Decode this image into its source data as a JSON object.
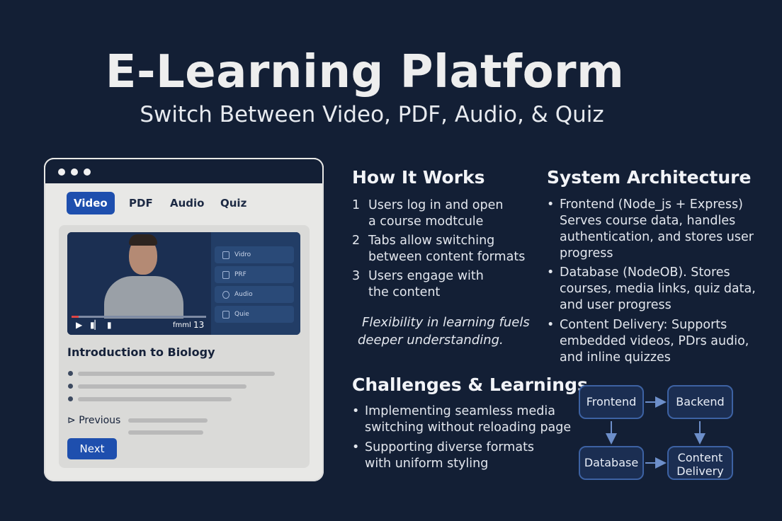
{
  "header": {
    "title": "E-Learning Platform",
    "subtitle": "Switch Between Video, PDF, Audio, & Quiz"
  },
  "mockup": {
    "tabs": [
      {
        "label": "Video",
        "active": true
      },
      {
        "label": "PDF",
        "active": false
      },
      {
        "label": "Audio",
        "active": false
      },
      {
        "label": "Quiz",
        "active": false
      }
    ],
    "player": {
      "side_items": [
        "Vidro",
        "PRF",
        "Audio",
        "Quie"
      ],
      "time_text": "fmml",
      "time_value": "13",
      "progress": 0.05
    },
    "course_title": "Introduction to Biology",
    "previous_label": "Previous",
    "next_label": "Next"
  },
  "how_it_works": {
    "heading": "How It Works",
    "steps": [
      {
        "num": "1",
        "line1": "Users log in and open",
        "line2": "a course modtcule"
      },
      {
        "num": "2",
        "line1": "Tabs allow switching",
        "line2": "between content formats"
      },
      {
        "num": "3",
        "line1": "Users engage with",
        "line2": "the content"
      }
    ],
    "quote_line1": "Flexibility in learning fuels",
    "quote_line2": "deeper understanding."
  },
  "challenges": {
    "heading": "Challenges & Learnings",
    "items": [
      {
        "line1": "Implementing seamless media",
        "line2": "switching without reloading page"
      },
      {
        "line1": "Supporting diverse formats",
        "line2": "with uniform styling"
      }
    ]
  },
  "architecture": {
    "heading": "System Architecture",
    "items": [
      {
        "lines": [
          "Frontend (Node_js + Express)",
          "Serves course data, handles",
          "authentication, and stores user",
          "progress"
        ]
      },
      {
        "lines": [
          "Database (NodeOB). Stores",
          "courses, media links, quiz data,",
          "and user progress"
        ]
      },
      {
        "lines": [
          "Content Delivery: Supports",
          "embedded videos, PDrs audio,",
          "and inline quizzes"
        ]
      }
    ],
    "diagram": {
      "frontend": "Frontend",
      "backend": "Backend",
      "database": "Database",
      "content_line1": "Content",
      "content_line2": "Delivery"
    }
  },
  "colors": {
    "background": "#131f35",
    "accent": "#1e4fae",
    "box_border": "#3d62a3"
  }
}
